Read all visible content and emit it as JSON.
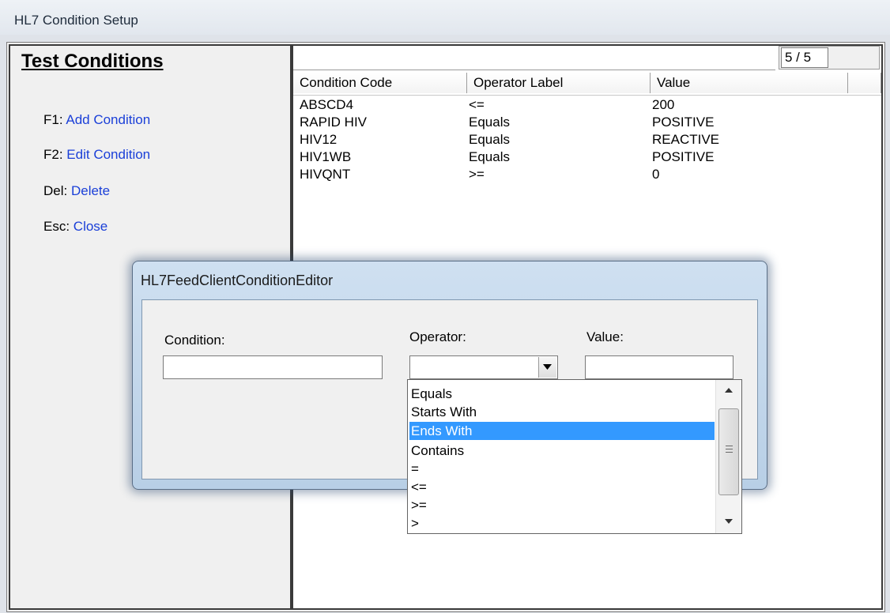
{
  "window": {
    "title": "HL7 Condition Setup"
  },
  "left_panel": {
    "heading": "Test Conditions",
    "shortcuts": [
      {
        "key": "F1:",
        "action": "Add Condition"
      },
      {
        "key": "F2:",
        "action": "Edit Condition"
      },
      {
        "key": "Del:",
        "action": "Delete"
      },
      {
        "key": "Esc:",
        "action": "Close"
      }
    ]
  },
  "grid": {
    "counter": "5 / 5",
    "columns": [
      "Condition Code",
      "Operator Label",
      "Value"
    ],
    "rows": [
      [
        "ABSCD4",
        "<=",
        "200"
      ],
      [
        "RAPID HIV",
        "Equals",
        "POSITIVE"
      ],
      [
        "HIV12",
        "Equals",
        "REACTIVE"
      ],
      [
        "HIV1WB",
        "Equals",
        "POSITIVE"
      ],
      [
        "HIVQNT",
        ">=",
        "0"
      ]
    ]
  },
  "dialog": {
    "title": "HL7FeedClientConditionEditor",
    "condition_label": "Condition:",
    "condition_value": "",
    "operator_label": "Operator:",
    "operator_value": "",
    "value_label": "Value:",
    "value_value": ""
  },
  "dropdown": {
    "options": [
      "Equals",
      "Starts With",
      "Ends With",
      "Contains",
      "=",
      "<=",
      ">=",
      ">"
    ],
    "selected": "Ends With"
  },
  "colors": {
    "link": "#1a3fd8",
    "selection": "#3399ff"
  },
  "icons": {
    "combo_arrow": "chevron-down-icon",
    "scroll_up": "scroll-up-icon",
    "scroll_down": "scroll-down-icon"
  }
}
